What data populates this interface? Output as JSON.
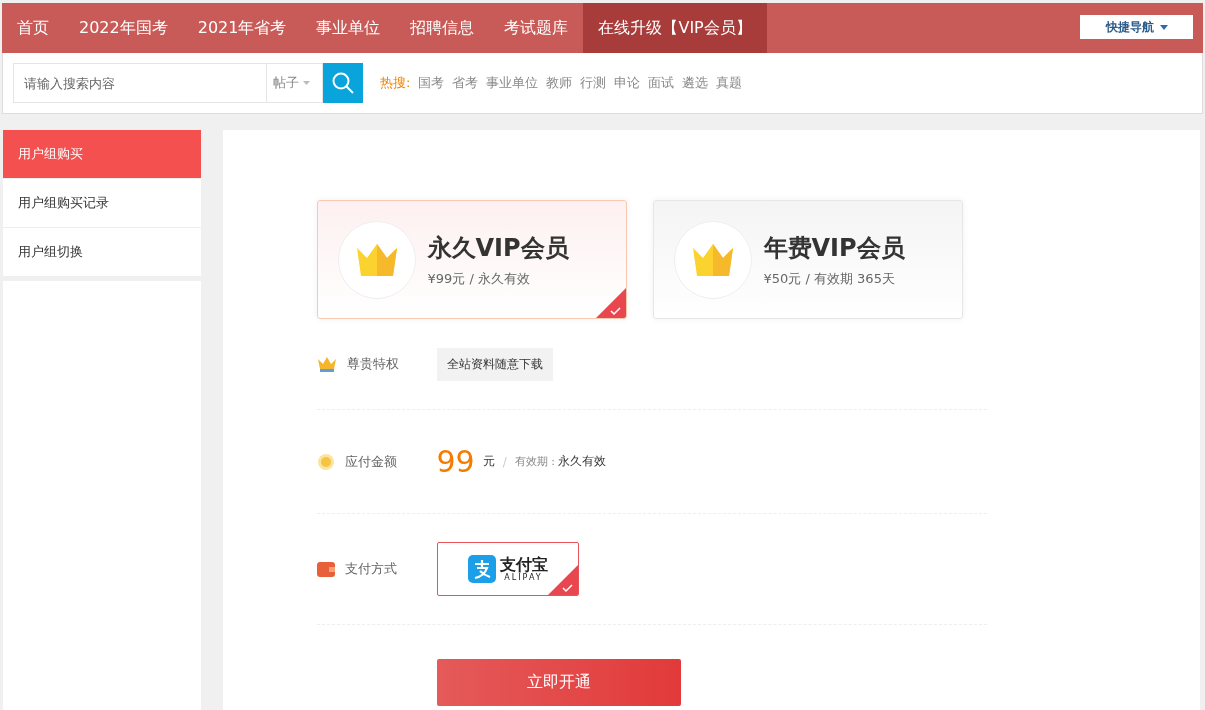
{
  "nav": {
    "items": [
      {
        "label": "首页",
        "selected": false
      },
      {
        "label": "2022年国考",
        "selected": false
      },
      {
        "label": "2021年省考",
        "selected": false
      },
      {
        "label": "事业单位",
        "selected": false
      },
      {
        "label": "招聘信息",
        "selected": false
      },
      {
        "label": "考试题库",
        "selected": false
      },
      {
        "label": "在线升级【VIP会员】",
        "selected": true
      }
    ],
    "quick_nav": "快捷导航"
  },
  "search": {
    "placeholder": "请输入搜索内容",
    "scope": "帖子",
    "hot_label": "热搜:",
    "hot": [
      "国考",
      "省考",
      "事业单位",
      "教师",
      "行测",
      "申论",
      "面试",
      "遴选",
      "真题"
    ]
  },
  "sidebar": {
    "items": [
      {
        "label": "用户组购买",
        "selected": true
      },
      {
        "label": "用户组购买记录",
        "selected": false
      },
      {
        "label": "用户组切换",
        "selected": false
      }
    ]
  },
  "plans": [
    {
      "name": "永久VIP会员",
      "price": "¥99元 / 永久有效",
      "selected": true
    },
    {
      "name": "年费VIP会员",
      "price": "¥50元 / 有效期 365天",
      "selected": false
    }
  ],
  "privilege": {
    "label": "尊贵特权",
    "tag": "全站资料随意下载"
  },
  "amount": {
    "label": "应付金额",
    "value": "99",
    "unit": "元",
    "sep": "/",
    "validity_label": "有效期 :",
    "validity": "永久有效"
  },
  "payment": {
    "label": "支付方式",
    "methods": [
      {
        "name": "支付宝",
        "sub": "ALIPAY",
        "selected": true
      }
    ]
  },
  "submit": "立即开通"
}
